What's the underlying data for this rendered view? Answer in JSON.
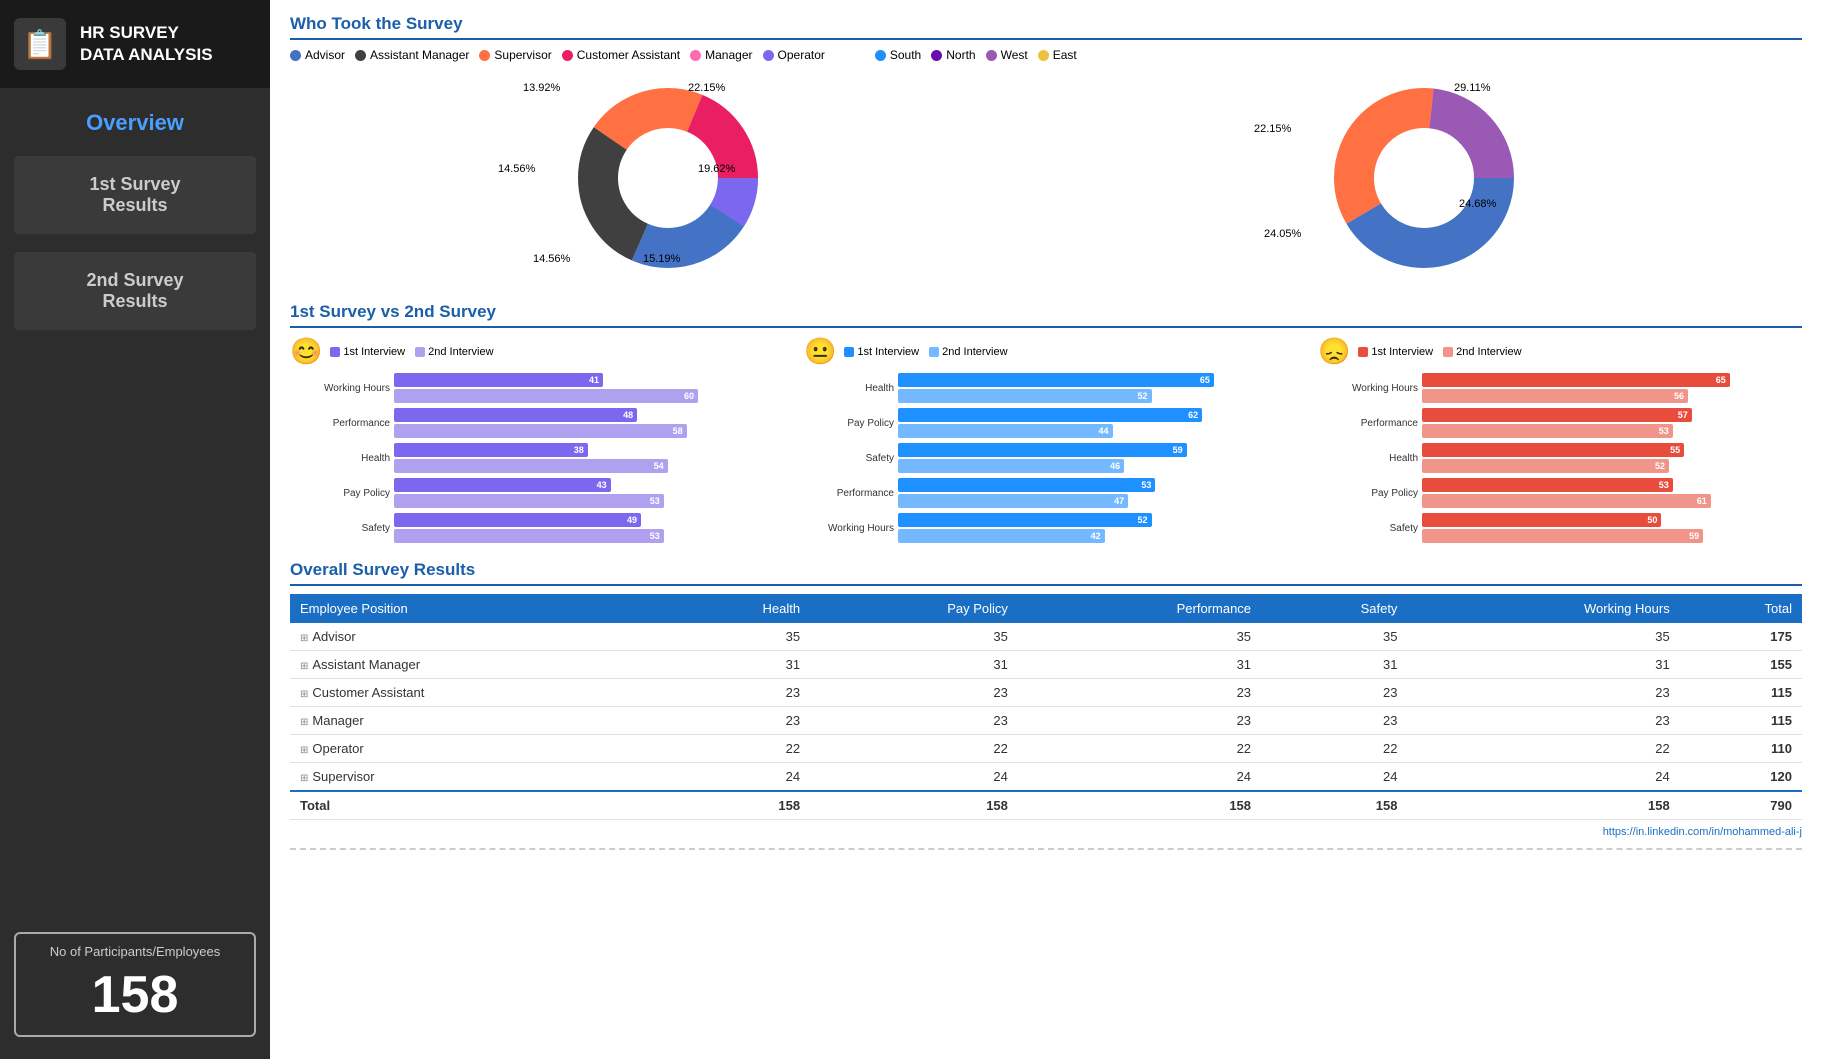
{
  "sidebar": {
    "logo_emoji": "📋",
    "title": "HR SURVEY\nDATA ANALYSIS",
    "overview_label": "Overview",
    "nav_items": [
      {
        "id": "1st-survey",
        "label": "1st Survey\nResults"
      },
      {
        "id": "2nd-survey",
        "label": "2nd Survey\nResults"
      }
    ],
    "stats_label": "No of Participants/Employees",
    "stats_number": "158"
  },
  "main": {
    "who_took_title": "Who Took the Survey",
    "survey_vs_title": "1st Survey vs 2nd Survey",
    "overall_title": "Overall Survey Results",
    "legend_roles": [
      {
        "label": "Advisor",
        "color": "#4472C4"
      },
      {
        "label": "Assistant Manager",
        "color": "#404040"
      },
      {
        "label": "Supervisor",
        "color": "#FF7043"
      },
      {
        "label": "Customer Assistant",
        "color": "#E91E63"
      },
      {
        "label": "Manager",
        "color": "#FF69B4"
      },
      {
        "label": "Operator",
        "color": "#7B68EE"
      }
    ],
    "legend_regions": [
      {
        "label": "South",
        "color": "#1E90FF"
      },
      {
        "label": "North",
        "color": "#6A0DAD"
      },
      {
        "label": "West",
        "color": "#9B59B6"
      },
      {
        "label": "East",
        "color": "#F0C040"
      }
    ],
    "donut_role": {
      "segments": [
        {
          "label": "22.15%",
          "color": "#4472C4",
          "pct": 22.15
        },
        {
          "label": "19.62%",
          "color": "#404040",
          "pct": 19.62
        },
        {
          "label": "15.19%",
          "color": "#FF7043",
          "pct": 15.19
        },
        {
          "label": "14.56%",
          "color": "#E91E63",
          "pct": 14.56
        },
        {
          "label": "14.56%",
          "color": "#FF69B4",
          "pct": 14.56
        },
        {
          "label": "13.92%",
          "color": "#7B68EE",
          "pct": 13.92
        }
      ]
    },
    "donut_region": {
      "segments": [
        {
          "label": "29.11%",
          "color": "#4472C4",
          "pct": 29.11
        },
        {
          "label": "24.68%",
          "color": "#FF7043",
          "pct": 24.68
        },
        {
          "label": "24.05%",
          "color": "#9B59B6",
          "pct": 24.05
        },
        {
          "label": "22.15%",
          "color": "#F0C040",
          "pct": 22.15
        }
      ]
    },
    "happy_chart": {
      "smiley": "😊",
      "legend": [
        {
          "label": "1st Interview",
          "color": "#7B68EE"
        },
        {
          "label": "2nd Interview",
          "color": "#B0A0F0"
        }
      ],
      "rows": [
        {
          "label": "Working Hours",
          "v1": 41,
          "v2": 60,
          "max": 75
        },
        {
          "label": "Performance",
          "v1": 48,
          "v2": 58,
          "max": 75
        },
        {
          "label": "Health",
          "v1": 38,
          "v2": 54,
          "max": 75
        },
        {
          "label": "Pay Policy",
          "v1": 43,
          "v2": 53,
          "max": 75
        },
        {
          "label": "Safety",
          "v1": 49,
          "v2": 53,
          "max": 75
        }
      ]
    },
    "neutral_chart": {
      "smiley": "😐",
      "legend": [
        {
          "label": "1st Interview",
          "color": "#1E90FF"
        },
        {
          "label": "2nd Interview",
          "color": "#74B9FF"
        }
      ],
      "rows": [
        {
          "label": "Health",
          "v1": 65,
          "v2": 52,
          "max": 80
        },
        {
          "label": "Pay Policy",
          "v1": 62,
          "v2": 44,
          "max": 80
        },
        {
          "label": "Safety",
          "v1": 59,
          "v2": 46,
          "max": 80
        },
        {
          "label": "Performance",
          "v1": 53,
          "v2": 47,
          "max": 80
        },
        {
          "label": "Working Hours",
          "v1": 52,
          "v2": 42,
          "max": 80
        }
      ]
    },
    "sad_chart": {
      "smiley": "😞",
      "legend": [
        {
          "label": "1st Interview",
          "color": "#E74C3C"
        },
        {
          "label": "2nd Interview",
          "color": "#F1948A"
        }
      ],
      "rows": [
        {
          "label": "Working Hours",
          "v1": 65,
          "v2": 56,
          "max": 80
        },
        {
          "label": "Performance",
          "v1": 57,
          "v2": 53,
          "max": 80
        },
        {
          "label": "Health",
          "v1": 55,
          "v2": 52,
          "max": 80
        },
        {
          "label": "Pay Policy",
          "v1": 53,
          "v2": 61,
          "max": 80
        },
        {
          "label": "Safety",
          "v1": 50,
          "v2": 59,
          "max": 80
        }
      ]
    },
    "table": {
      "headers": [
        "Employee Position",
        "Health",
        "Pay Policy",
        "Performance",
        "Safety",
        "Working Hours",
        "Total"
      ],
      "rows": [
        {
          "pos": "Advisor",
          "health": 35,
          "pay": 35,
          "perf": 35,
          "safety": 35,
          "wh": 35,
          "total": 175
        },
        {
          "pos": "Assistant Manager",
          "health": 31,
          "pay": 31,
          "perf": 31,
          "safety": 31,
          "wh": 31,
          "total": 155
        },
        {
          "pos": "Customer Assistant",
          "health": 23,
          "pay": 23,
          "perf": 23,
          "safety": 23,
          "wh": 23,
          "total": 115
        },
        {
          "pos": "Manager",
          "health": 23,
          "pay": 23,
          "perf": 23,
          "safety": 23,
          "wh": 23,
          "total": 115
        },
        {
          "pos": "Operator",
          "health": 22,
          "pay": 22,
          "perf": 22,
          "safety": 22,
          "wh": 22,
          "total": 110
        },
        {
          "pos": "Supervisor",
          "health": 24,
          "pay": 24,
          "perf": 24,
          "safety": 24,
          "wh": 24,
          "total": 120
        }
      ],
      "totals": {
        "pos": "Total",
        "health": 158,
        "pay": 158,
        "perf": 158,
        "safety": 158,
        "wh": 158,
        "total": 790
      }
    },
    "footer_link": "https://in.linkedin.com/in/mohammed-ali-j"
  }
}
